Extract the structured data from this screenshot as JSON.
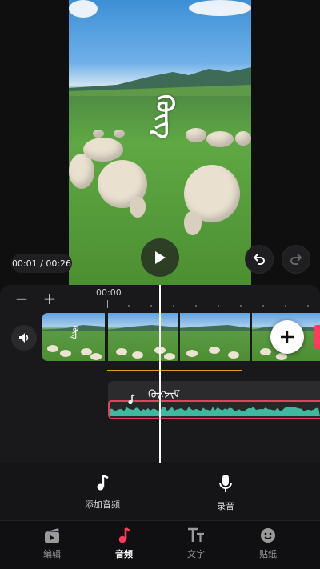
{
  "preview": {
    "caption": "ᠬᠥᠭ",
    "time_readout": "00:01 / 00:26"
  },
  "timeline": {
    "ruler_time": "00:00",
    "zoom_out_label": "−",
    "zoom_in_label": "+",
    "first_clip_caption": "ᠬᠥᠭ",
    "audio_track_label": "ᠬᠥᠭᠵᠢᠮ"
  },
  "actions": [
    {
      "label": "添加音频",
      "icon": "music-note-icon"
    },
    {
      "label": "录音",
      "icon": "microphone-icon"
    }
  ],
  "tabs": [
    {
      "label": "编辑",
      "icon": "clapperboard-icon",
      "active": false
    },
    {
      "label": "音频",
      "icon": "music-note-icon",
      "active": true
    },
    {
      "label": "文字",
      "icon": "text-icon",
      "active": false
    },
    {
      "label": "贴纸",
      "icon": "sticker-smile-icon",
      "active": false
    }
  ],
  "colors": {
    "accent": "#ff3a5c",
    "playhead": "#ffffff",
    "waveform": "#3fb8a0",
    "text_track": "#e59a2d",
    "background": "#0f0f10"
  }
}
